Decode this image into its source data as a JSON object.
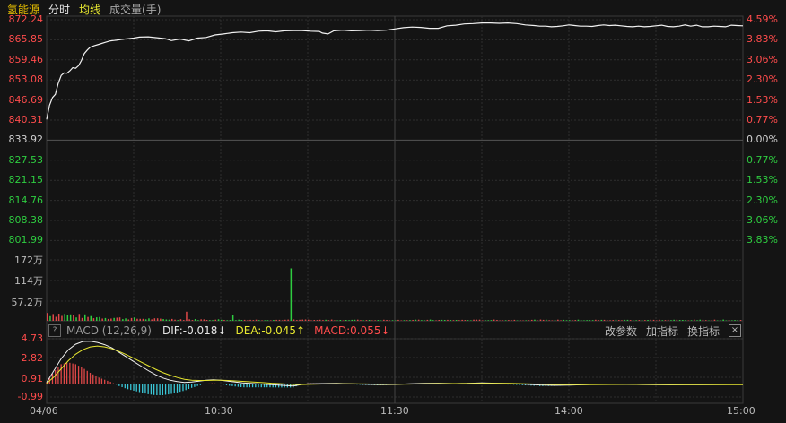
{
  "header": {
    "stock_name": "氢能源",
    "tab_fenshi": "分时",
    "tab_junxian": "均线",
    "volume_label": "成交量(手)"
  },
  "price_axis": {
    "left": [
      "872.24",
      "865.85",
      "859.46",
      "853.08",
      "846.69",
      "840.31",
      "833.92",
      "827.53",
      "821.15",
      "814.76",
      "808.38",
      "801.99"
    ],
    "right": [
      "4.59%",
      "3.83%",
      "3.06%",
      "2.30%",
      "1.53%",
      "0.77%",
      "0.00%",
      "0.77%",
      "1.53%",
      "2.30%",
      "3.06%",
      "3.83%"
    ],
    "colors": {
      "up": "#ff4c4c",
      "flat": "#d0d0d0",
      "down": "#2ecc40"
    }
  },
  "volume_axis": [
    "172万",
    "114万",
    "57.2万"
  ],
  "macd_axis": [
    "4.73",
    "2.82",
    "0.91",
    "-0.99"
  ],
  "macd_bar": {
    "help": "?",
    "name": "MACD (12,26,9)",
    "dif": "DIF:-0.018↓",
    "dea": "DEA:-0.045↑",
    "macd": "MACD:0.055↓",
    "btn_change": "改参数",
    "btn_add": "加指标",
    "btn_switch": "换指标",
    "close": "×"
  },
  "time_axis": [
    "04/06",
    "10:30",
    "11:30",
    "14:00",
    "15:00"
  ],
  "chart_data": {
    "type": "line",
    "title": "",
    "prev_close": 833.92,
    "ylim": [
      801.99,
      872.24
    ],
    "x_sessions": [
      "09:30-11:30",
      "13:00-15:00"
    ],
    "price_series": [
      [
        0,
        840.5
      ],
      [
        2,
        845
      ],
      [
        4,
        847.5
      ],
      [
        6,
        848.5
      ],
      [
        8,
        852
      ],
      [
        10,
        854.5
      ],
      [
        12,
        855.3
      ],
      [
        14,
        855.2
      ],
      [
        16,
        856
      ],
      [
        18,
        857
      ],
      [
        20,
        856.8
      ],
      [
        22,
        857.6
      ],
      [
        24,
        859.3
      ],
      [
        26,
        861.5
      ],
      [
        28,
        862.6
      ],
      [
        30,
        863.5
      ],
      [
        33,
        864
      ],
      [
        36,
        864.4
      ],
      [
        40,
        865
      ],
      [
        44,
        865.5
      ],
      [
        48,
        865.7
      ],
      [
        52,
        866
      ],
      [
        56,
        866.2
      ],
      [
        60,
        866.4
      ],
      [
        64,
        866.7
      ],
      [
        70,
        866.8
      ],
      [
        76,
        866.5
      ],
      [
        82,
        866.2
      ],
      [
        86,
        865.6
      ],
      [
        92,
        866.1
      ],
      [
        98,
        865.5
      ],
      [
        104,
        866.4
      ],
      [
        110,
        866.6
      ],
      [
        116,
        867.4
      ],
      [
        122,
        867.7
      ],
      [
        128,
        868.1
      ],
      [
        134,
        868.3
      ],
      [
        140,
        868.1
      ],
      [
        146,
        868.6
      ],
      [
        152,
        868.7
      ],
      [
        158,
        868.4
      ],
      [
        164,
        868.7
      ],
      [
        170,
        868.8
      ],
      [
        176,
        868.8
      ],
      [
        182,
        868.6
      ],
      [
        188,
        868.5
      ],
      [
        190,
        868.0
      ],
      [
        194,
        867.7
      ],
      [
        198,
        868.7
      ],
      [
        204,
        868.9
      ],
      [
        210,
        868.7
      ],
      [
        216,
        868.8
      ],
      [
        222,
        868.9
      ],
      [
        228,
        868.8
      ],
      [
        234,
        868.9
      ],
      [
        240,
        869.3
      ],
      [
        246,
        869.7
      ],
      [
        252,
        869.9
      ],
      [
        258,
        869.8
      ],
      [
        264,
        869.5
      ],
      [
        270,
        869.5
      ],
      [
        276,
        870.3
      ],
      [
        282,
        870.5
      ],
      [
        288,
        870.9
      ],
      [
        294,
        871.0
      ],
      [
        300,
        871.2
      ],
      [
        306,
        871.2
      ],
      [
        312,
        871.1
      ],
      [
        318,
        871.2
      ],
      [
        324,
        871.0
      ],
      [
        330,
        870.6
      ],
      [
        336,
        870.4
      ],
      [
        340,
        870.2
      ],
      [
        344,
        870.2
      ],
      [
        348,
        870.0
      ],
      [
        352,
        870.1
      ],
      [
        356,
        870.3
      ],
      [
        360,
        870.6
      ],
      [
        364,
        870.4
      ],
      [
        368,
        870.2
      ],
      [
        372,
        870.2
      ],
      [
        376,
        870.1
      ],
      [
        380,
        870.4
      ],
      [
        384,
        870.6
      ],
      [
        388,
        870.4
      ],
      [
        392,
        870.5
      ],
      [
        396,
        870.3
      ],
      [
        400,
        870.1
      ],
      [
        404,
        870.0
      ],
      [
        408,
        870.2
      ],
      [
        412,
        870.0
      ],
      [
        416,
        870.1
      ],
      [
        420,
        870.3
      ],
      [
        424,
        870.5
      ],
      [
        428,
        870.1
      ],
      [
        432,
        870.0
      ],
      [
        436,
        870.2
      ],
      [
        440,
        870.6
      ],
      [
        444,
        870.2
      ],
      [
        448,
        870.5
      ],
      [
        452,
        870.0
      ],
      [
        456,
        870.0
      ],
      [
        460,
        870.2
      ],
      [
        464,
        870.1
      ],
      [
        468,
        870.0
      ],
      [
        472,
        870.5
      ],
      [
        476,
        870.4
      ],
      [
        480,
        870.3
      ]
    ],
    "volume_ylim": [
      0,
      2000000
    ],
    "volume_spike": {
      "minute": 168,
      "value": 1720000
    },
    "macd_ylim": [
      -1.5,
      5.0
    ],
    "dif_series": [
      [
        0,
        0.2
      ],
      [
        5,
        1.5
      ],
      [
        10,
        2.8
      ],
      [
        15,
        3.8
      ],
      [
        20,
        4.4
      ],
      [
        25,
        4.7
      ],
      [
        30,
        4.73
      ],
      [
        35,
        4.6
      ],
      [
        40,
        4.35
      ],
      [
        45,
        4.0
      ],
      [
        50,
        3.5
      ],
      [
        55,
        3.0
      ],
      [
        60,
        2.5
      ],
      [
        65,
        2.0
      ],
      [
        70,
        1.5
      ],
      [
        75,
        1.05
      ],
      [
        80,
        0.7
      ],
      [
        85,
        0.45
      ],
      [
        90,
        0.3
      ],
      [
        95,
        0.2
      ],
      [
        100,
        0.25
      ],
      [
        105,
        0.35
      ],
      [
        110,
        0.45
      ],
      [
        115,
        0.5
      ],
      [
        120,
        0.45
      ],
      [
        125,
        0.35
      ],
      [
        130,
        0.25
      ],
      [
        135,
        0.15
      ],
      [
        140,
        0.1
      ],
      [
        145,
        0.05
      ],
      [
        150,
        0.0
      ],
      [
        155,
        -0.05
      ],
      [
        160,
        -0.1
      ],
      [
        165,
        -0.15
      ],
      [
        170,
        -0.2
      ],
      [
        175,
        -0.05
      ],
      [
        180,
        0.05
      ],
      [
        190,
        0.08
      ],
      [
        200,
        0.1
      ],
      [
        210,
        0.05
      ],
      [
        220,
        0.0
      ],
      [
        230,
        -0.05
      ],
      [
        240,
        -0.02
      ],
      [
        250,
        0.05
      ],
      [
        260,
        0.1
      ],
      [
        270,
        0.12
      ],
      [
        280,
        0.08
      ],
      [
        290,
        0.1
      ],
      [
        300,
        0.15
      ],
      [
        310,
        0.12
      ],
      [
        320,
        0.08
      ],
      [
        330,
        0.0
      ],
      [
        340,
        -0.08
      ],
      [
        350,
        -0.12
      ],
      [
        360,
        -0.1
      ],
      [
        370,
        -0.05
      ],
      [
        380,
        0.0
      ],
      [
        390,
        0.02
      ],
      [
        400,
        0.0
      ],
      [
        410,
        -0.03
      ],
      [
        420,
        -0.05
      ],
      [
        430,
        -0.06
      ],
      [
        440,
        -0.05
      ],
      [
        450,
        -0.04
      ],
      [
        460,
        -0.03
      ],
      [
        470,
        -0.02
      ],
      [
        480,
        -0.018
      ]
    ],
    "dea_series": [
      [
        0,
        0.1
      ],
      [
        5,
        0.8
      ],
      [
        10,
        1.7
      ],
      [
        15,
        2.6
      ],
      [
        20,
        3.3
      ],
      [
        25,
        3.8
      ],
      [
        30,
        4.1
      ],
      [
        35,
        4.2
      ],
      [
        40,
        4.1
      ],
      [
        45,
        3.9
      ],
      [
        50,
        3.6
      ],
      [
        55,
        3.25
      ],
      [
        60,
        2.85
      ],
      [
        65,
        2.45
      ],
      [
        70,
        2.05
      ],
      [
        75,
        1.65
      ],
      [
        80,
        1.3
      ],
      [
        85,
        1.0
      ],
      [
        90,
        0.75
      ],
      [
        95,
        0.55
      ],
      [
        100,
        0.45
      ],
      [
        105,
        0.42
      ],
      [
        110,
        0.42
      ],
      [
        115,
        0.44
      ],
      [
        120,
        0.44
      ],
      [
        125,
        0.42
      ],
      [
        130,
        0.37
      ],
      [
        135,
        0.32
      ],
      [
        140,
        0.27
      ],
      [
        145,
        0.22
      ],
      [
        150,
        0.17
      ],
      [
        155,
        0.12
      ],
      [
        160,
        0.08
      ],
      [
        165,
        0.03
      ],
      [
        170,
        -0.02
      ],
      [
        175,
        -0.03
      ],
      [
        180,
        -0.01
      ],
      [
        190,
        0.03
      ],
      [
        200,
        0.06
      ],
      [
        210,
        0.06
      ],
      [
        220,
        0.04
      ],
      [
        230,
        0.01
      ],
      [
        240,
        0.0
      ],
      [
        250,
        0.02
      ],
      [
        260,
        0.05
      ],
      [
        270,
        0.08
      ],
      [
        280,
        0.08
      ],
      [
        290,
        0.09
      ],
      [
        300,
        0.11
      ],
      [
        310,
        0.11
      ],
      [
        320,
        0.1
      ],
      [
        330,
        0.06
      ],
      [
        340,
        0.02
      ],
      [
        350,
        -0.03
      ],
      [
        360,
        -0.05
      ],
      [
        370,
        -0.05
      ],
      [
        380,
        -0.03
      ],
      [
        390,
        -0.02
      ],
      [
        400,
        -0.01
      ],
      [
        410,
        -0.02
      ],
      [
        420,
        -0.03
      ],
      [
        430,
        -0.04
      ],
      [
        440,
        -0.045
      ],
      [
        450,
        -0.045
      ],
      [
        460,
        -0.045
      ],
      [
        470,
        -0.045
      ],
      [
        480,
        -0.045
      ]
    ]
  }
}
